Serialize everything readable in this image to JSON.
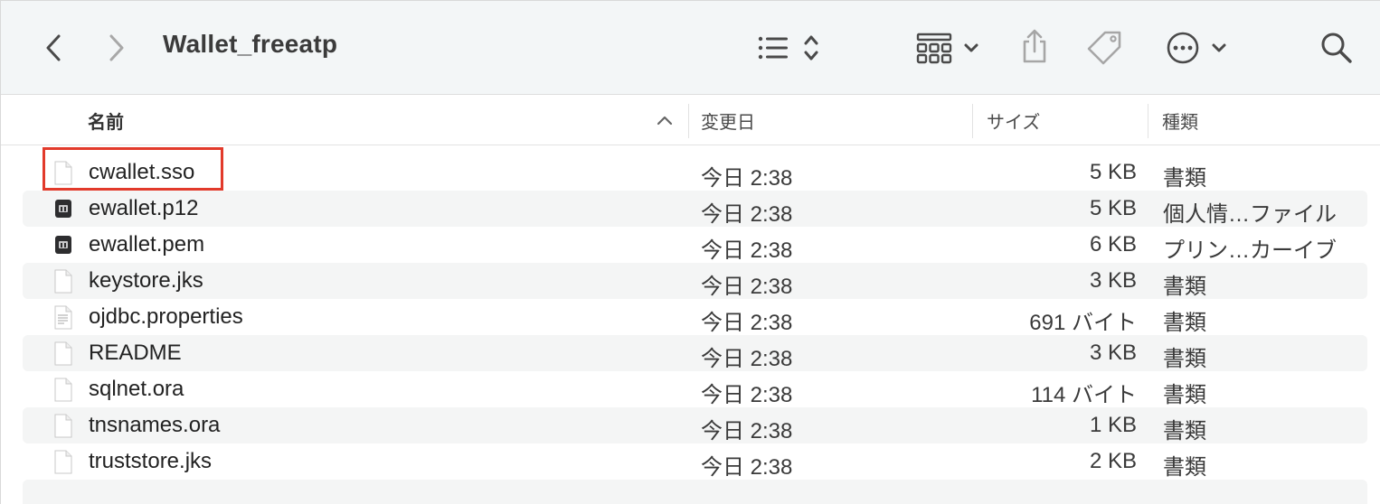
{
  "toolbar": {
    "title": "Wallet_freeatp",
    "icons": [
      "chevron-left-icon",
      "chevron-right-icon",
      "list-view-icon",
      "grid-view-icon",
      "share-icon",
      "tag-icon",
      "more-icon",
      "search-icon"
    ]
  },
  "columns": {
    "name": "名前",
    "date": "変更日",
    "size": "サイズ",
    "kind": "種類"
  },
  "files": [
    {
      "name": "cwallet.sso",
      "date": "今日 2:38",
      "size": "5 KB",
      "kind": "書類",
      "icon": "document-icon"
    },
    {
      "name": "ewallet.p12",
      "date": "今日 2:38",
      "size": "5 KB",
      "kind": "個人情…ファイル",
      "icon": "certificate-icon"
    },
    {
      "name": "ewallet.pem",
      "date": "今日 2:38",
      "size": "6 KB",
      "kind": "プリン…カーイブ",
      "icon": "certificate-icon"
    },
    {
      "name": "keystore.jks",
      "date": "今日 2:38",
      "size": "3 KB",
      "kind": "書類",
      "icon": "document-icon"
    },
    {
      "name": "ojdbc.properties",
      "date": "今日 2:38",
      "size": "691 バイト",
      "kind": "書類",
      "icon": "text-document-icon"
    },
    {
      "name": "README",
      "date": "今日 2:38",
      "size": "3 KB",
      "kind": "書類",
      "icon": "document-icon"
    },
    {
      "name": "sqlnet.ora",
      "date": "今日 2:38",
      "size": "114 バイト",
      "kind": "書類",
      "icon": "document-icon"
    },
    {
      "name": "tnsnames.ora",
      "date": "今日 2:38",
      "size": "1 KB",
      "kind": "書類",
      "icon": "document-icon"
    },
    {
      "name": "truststore.jks",
      "date": "今日 2:38",
      "size": "2 KB",
      "kind": "書類",
      "icon": "document-icon"
    }
  ],
  "highlight_color": "#e23a2b"
}
